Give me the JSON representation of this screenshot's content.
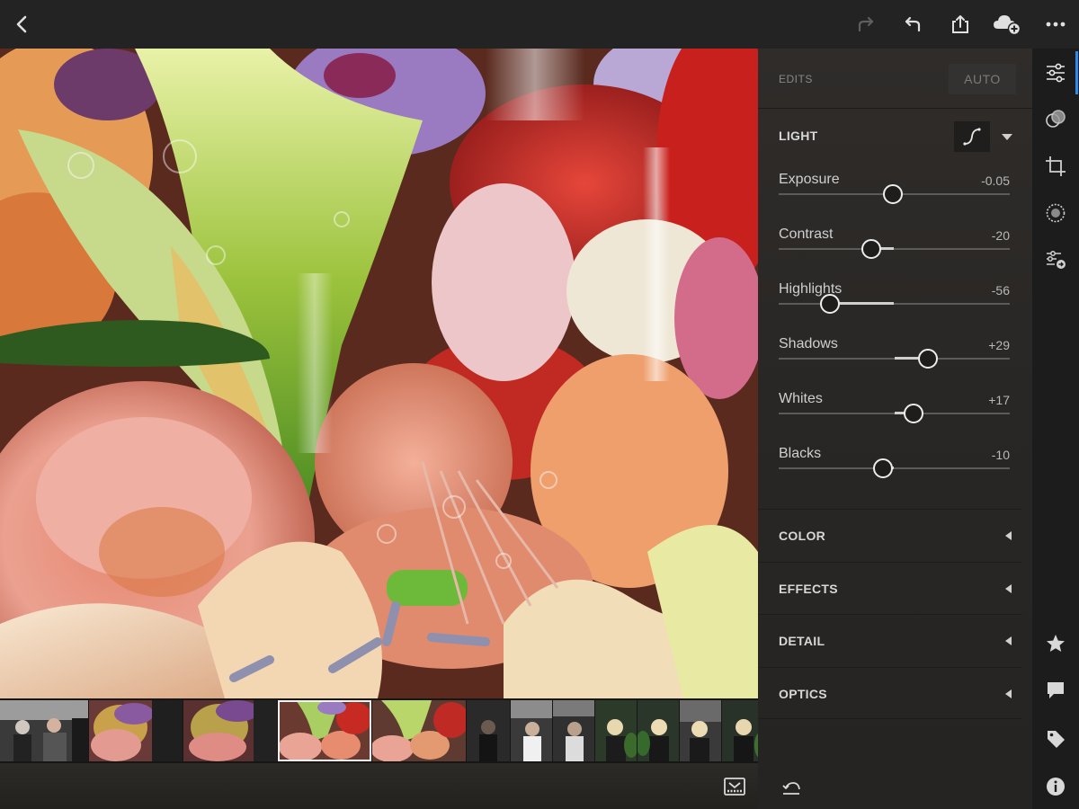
{
  "toolbar": {
    "back_icon": "chevron-left-icon",
    "redo_icon": "redo-icon",
    "undo_icon": "undo-icon",
    "share_icon": "share-icon",
    "cloud_icon": "cloud-add-icon",
    "more_icon": "more-horizontal-icon"
  },
  "edits": {
    "title": "EDITS",
    "auto_label": "AUTO"
  },
  "light": {
    "title": "LIGHT",
    "curve_icon": "tone-curve-icon",
    "sliders": [
      {
        "label": "Exposure",
        "value": "-0.05",
        "level": -0.01
      },
      {
        "label": "Contrast",
        "value": "-20",
        "level": -0.2
      },
      {
        "label": "Highlights",
        "value": "-56",
        "level": -0.56
      },
      {
        "label": "Shadows",
        "value": "+29",
        "level": 0.29
      },
      {
        "label": "Whites",
        "value": "+17",
        "level": 0.17
      },
      {
        "label": "Blacks",
        "value": "-10",
        "level": -0.1
      }
    ]
  },
  "sections": [
    {
      "label": "COLOR"
    },
    {
      "label": "EFFECTS"
    },
    {
      "label": "DETAIL"
    },
    {
      "label": "OPTICS"
    }
  ],
  "rail": {
    "top": [
      "sliders-icon",
      "color-mix-icon",
      "crop-icon",
      "selective-icon",
      "presets-icon"
    ],
    "bottom": [
      "star-icon",
      "comment-icon",
      "tag-icon",
      "info-icon"
    ]
  },
  "filmstrip": {
    "selected_index": 3,
    "thumb_count": 11
  },
  "colors": {
    "accent": "#2d8ceb",
    "panel": "#2b2927",
    "toolbar": "#232323"
  }
}
